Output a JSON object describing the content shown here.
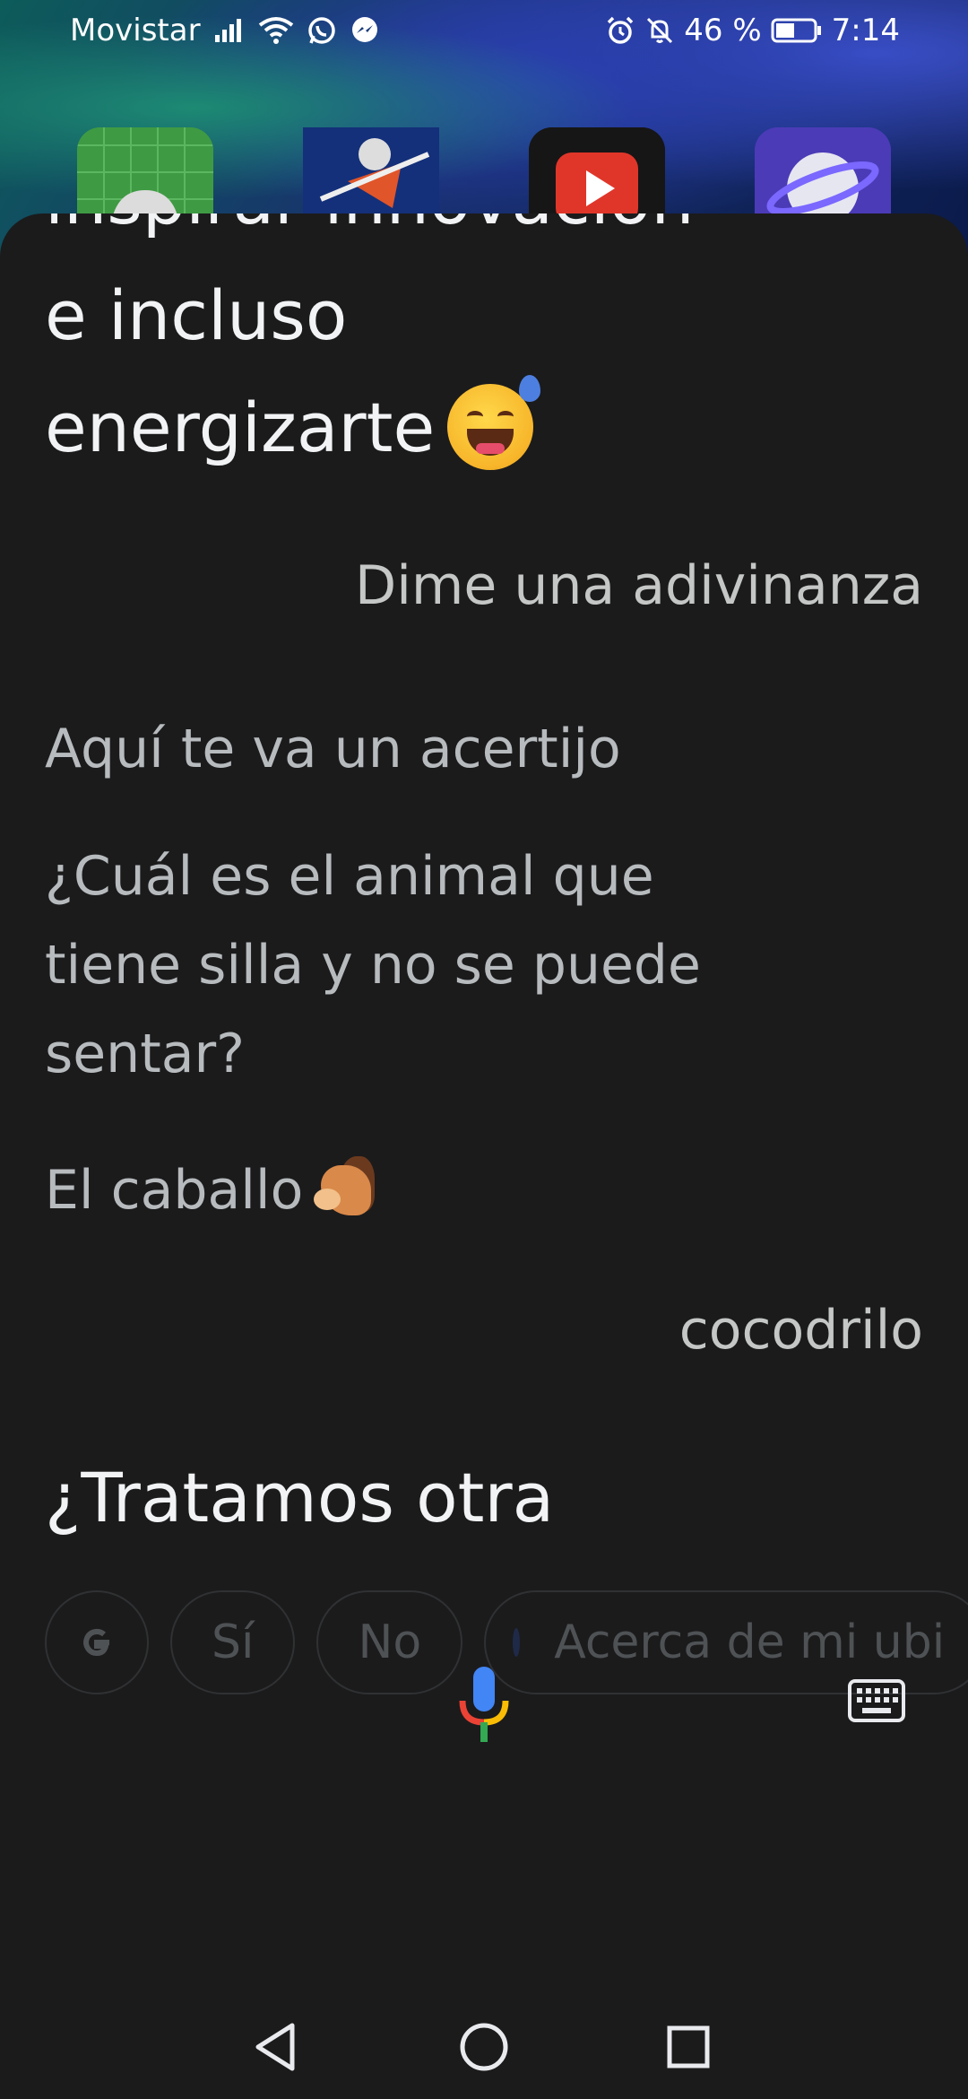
{
  "statusbar": {
    "carrier": "Movistar",
    "battery_percent": "46 %",
    "time": "7:14"
  },
  "conversation": {
    "cut_line": "inspirar innovación",
    "line1": "e incluso",
    "line2": "energizarte",
    "user_message_1": "Dime una adivinanza",
    "reply_intro": "Aquí te va un acertijo",
    "riddle": "¿Cuál es el animal que tiene silla y no se puede sentar?",
    "answer": "El caballo",
    "user_message_2": "cocodrilo",
    "followup": "¿Tratamos otra"
  },
  "chips": {
    "yes": "Sí",
    "no": "No",
    "location": "Acerca de mi ubi"
  },
  "colors": {
    "sheet_bg": "#1b1b1c",
    "mic_blue": "#4285f4",
    "mic_red": "#ea4335",
    "mic_yellow": "#fbbc05",
    "mic_green": "#34a853"
  }
}
